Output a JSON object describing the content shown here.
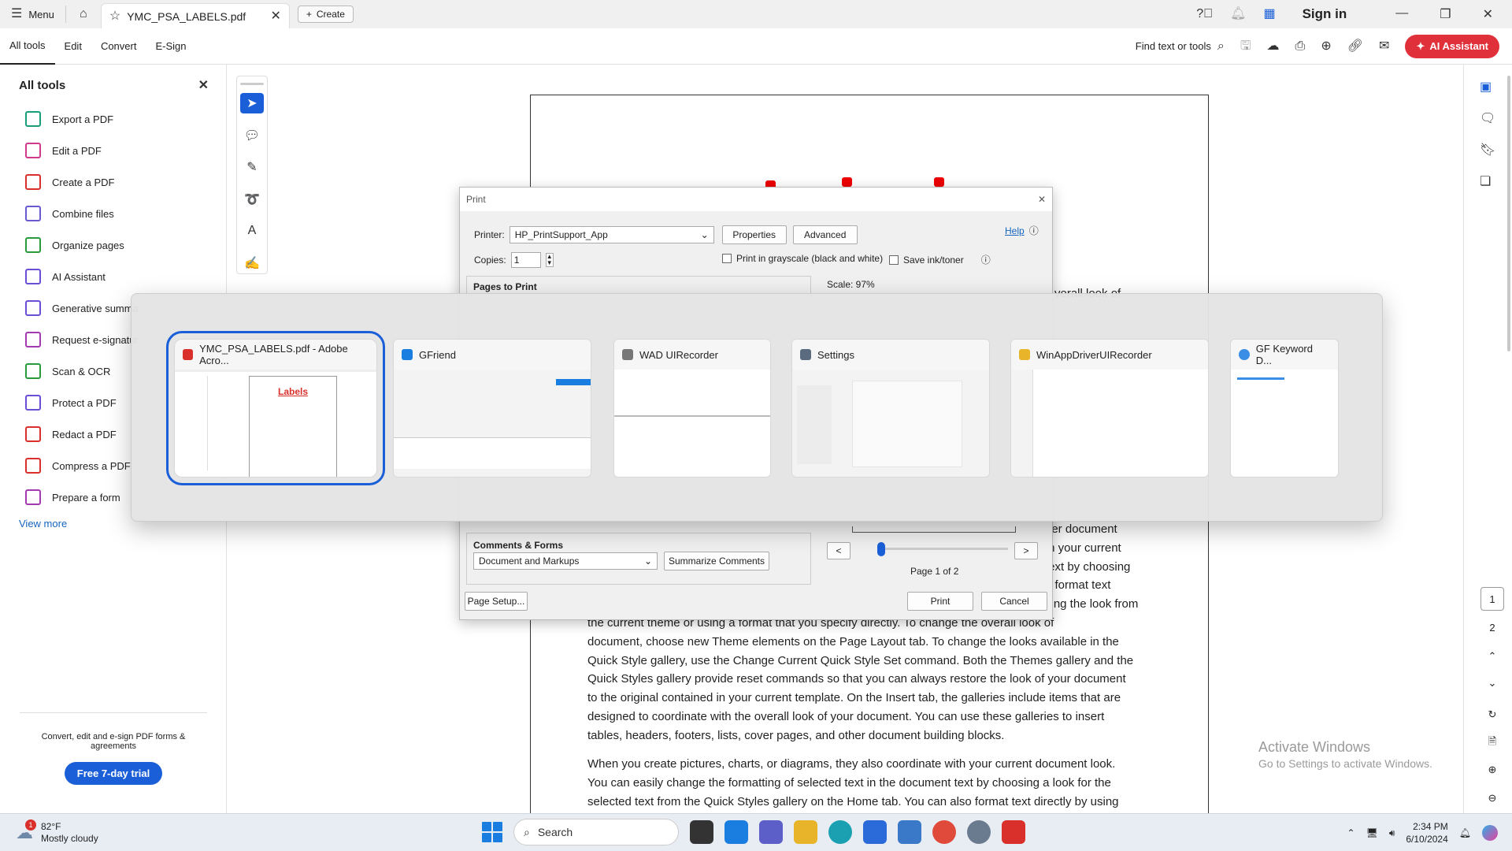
{
  "titlebar": {
    "menu_label": "Menu",
    "tab_title": "YMC_PSA_LABELS.pdf",
    "create_label": "Create",
    "sign_in": "Sign in"
  },
  "menubar": {
    "items": [
      "All tools",
      "Edit",
      "Convert",
      "E-Sign"
    ],
    "find_label": "Find text or tools",
    "ai_assistant": "AI Assistant"
  },
  "left_panel": {
    "title": "All tools",
    "items": [
      {
        "label": "Export a PDF",
        "color": "#1a9e7a"
      },
      {
        "label": "Edit a PDF",
        "color": "#d13a8a"
      },
      {
        "label": "Create a PDF",
        "color": "#d9302c"
      },
      {
        "label": "Combine files",
        "color": "#6a5ad0"
      },
      {
        "label": "Organize pages",
        "color": "#2a9a3a"
      },
      {
        "label": "AI Assistant",
        "color": "#6a4fd6"
      },
      {
        "label": "Generative summa",
        "color": "#6a4fd6"
      },
      {
        "label": "Request e-signatur",
        "color": "#a43ab2"
      },
      {
        "label": "Scan & OCR",
        "color": "#2a9a3a"
      },
      {
        "label": "Protect a PDF",
        "color": "#6a4fd6"
      },
      {
        "label": "Redact a PDF",
        "color": "#d9302c"
      },
      {
        "label": "Compress a PDF",
        "color": "#d9302c"
      },
      {
        "label": "Prepare a form",
        "color": "#a43ab2"
      }
    ],
    "view_more": "View more",
    "promo_text": "Convert, edit and e-sign PDF forms & agreements",
    "trial_button": "Free 7-day trial"
  },
  "document": {
    "partial_top": "verall look of",
    "lines_right": [
      "her document",
      "th your current",
      "text by choosing",
      "o format text",
      "sing the look from"
    ],
    "paragraph1": [
      "the current theme or using a format that you specify directly. To change the overall look of",
      "document, choose new Theme elements on the Page Layout tab. To change the looks available in the",
      "Quick Style gallery, use the Change Current Quick Style Set command. Both the Themes gallery and the",
      "Quick Styles gallery provide reset commands so that you can always restore the look of your document",
      "to the original contained in your current template. On the Insert tab, the galleries include items that are",
      "designed to coordinate with the overall look of your document. You can use these galleries to insert",
      "tables, headers, footers, lists, cover pages, and other document building blocks."
    ],
    "paragraph2": [
      "When you create pictures, charts, or diagrams, they also coordinate with your current document look.",
      "You can easily change the formatting of selected text in the document text by choosing a look for the",
      "selected text from the Quick Styles gallery on the Home tab. You can also format text directly by using"
    ]
  },
  "page_nav": {
    "pages": [
      "1",
      "2"
    ],
    "current": "1"
  },
  "activate": {
    "title": "Activate Windows",
    "subtitle": "Go to Settings to activate Windows."
  },
  "print_dialog": {
    "title": "Print",
    "printer_label": "Printer:",
    "printer_value": "HP_PrintSupport_App",
    "properties": "Properties",
    "advanced": "Advanced",
    "help": "Help",
    "copies_label": "Copies:",
    "copies_value": "1",
    "grayscale": "Print in grayscale (black and white)",
    "save_ink": "Save ink/toner",
    "pages_to_print": "Pages to Print",
    "scale": "Scale:  97%",
    "comments_forms": "Comments & Forms",
    "comments_value": "Document and Markups",
    "summarize": "Summarize Comments",
    "page_indicator": "Page 1 of 2",
    "prev": "<",
    "next": ">",
    "page_setup": "Page Setup...",
    "print": "Print",
    "cancel": "Cancel"
  },
  "task_switcher": {
    "windows": [
      {
        "title": "YMC_PSA_LABELS.pdf - Adobe Acro...",
        "icon_color": "#d9302c",
        "preview_heading": "Labels"
      },
      {
        "title": "GFriend",
        "icon_color": "#1a7de0"
      },
      {
        "title": "WAD UIRecorder",
        "icon_color": "#777777"
      },
      {
        "title": "Settings",
        "icon_color": "#5b6b7f"
      },
      {
        "title": "WinAppDriverUIRecorder",
        "icon_color": "#e8b52a"
      },
      {
        "title": "GF Keyword D...",
        "icon_color": "#3a8ee6"
      }
    ]
  },
  "taskbar": {
    "badge": "1",
    "temperature": "82°F",
    "weather": "Mostly cloudy",
    "search_placeholder": "Search",
    "time": "2:34 PM",
    "date": "6/10/2024"
  }
}
